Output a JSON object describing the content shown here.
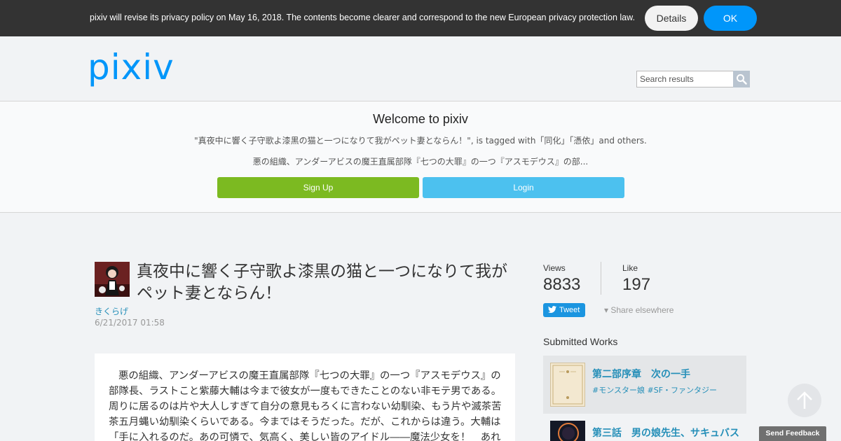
{
  "privacy_bar": {
    "message": "pixiv will revise its privacy policy on May 16, 2018. The contents become clearer and correspond to the new European privacy protection law.",
    "details_label": "Details",
    "ok_label": "OK"
  },
  "header": {
    "logo_text": "pixiv",
    "search_placeholder": "Search results",
    "search_icon": "search-icon"
  },
  "welcome": {
    "title": "Welcome to pixiv",
    "subtitle": "\"真夜中に響く子守歌よ漆黒の猫と一つになりて我がペット妻とならん！\", is tagged with「同化」「憑依」and others.",
    "description": "悪の組織、アンダーアビスの魔王直属部隊『七つの大罪』の一つ『アスモデウス』の部...",
    "signup_label": "Sign Up",
    "login_label": "Login"
  },
  "work": {
    "title": "真夜中に響く子守歌よ漆黒の猫と一つになりて我がペット妻とならん！",
    "author": "きくらげ",
    "date": "6/21/2017 01:58",
    "caption": "悪の組織、アンダーアビスの魔王直属部隊『七つの大罪』の一つ『アスモデウス』の部隊長、ラストこと紫藤大輔は今まで彼女が一度もできたことのない非モテ男である。周りに居るのは片や大人しすぎて自分の意見もろくに言わない幼馴染、もう片や滅茶苦茶五月蝿い幼馴染くらいである。今まではそうだった。だが、これからは違う。大輔は「手に入れるのだ。あの可憐で、気高く、美しい皆のアイドル――魔法少女を！　あれを俺の"
  },
  "sidebar": {
    "views_label": "Views",
    "views_value": "8833",
    "like_label": "Like",
    "like_value": "197",
    "tweet_label": "Tweet",
    "share_label": "▾ Share elsewhere",
    "submitted_title": "Submitted Works",
    "works": [
      {
        "title": "第二部序章　次の一手",
        "tags": "#モンスター娘 #SF・ファンタジー"
      },
      {
        "title": "第三話　男の娘先生、サキュバス"
      }
    ]
  },
  "feedback_label": "Send Feedback",
  "colors": {
    "brand": "#0096fa",
    "signup": "#7cba21",
    "login": "#4cc1ef",
    "link": "#258fb8"
  }
}
